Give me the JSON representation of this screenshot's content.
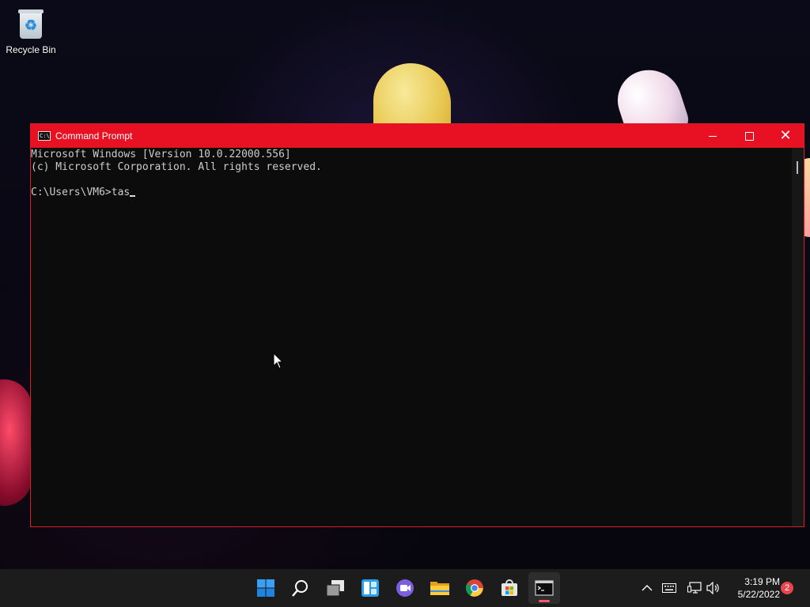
{
  "desktop": {
    "icons": [
      {
        "label": "Recycle Bin"
      }
    ]
  },
  "window": {
    "title": "Command Prompt",
    "console_lines": [
      "Microsoft Windows [Version 10.0.22000.556]",
      "(c) Microsoft Corporation. All rights reserved.",
      "",
      "C:\\Users\\VM6>tas"
    ]
  },
  "taskbar": {
    "apps": [
      "start-icon",
      "search-icon",
      "task-view-icon",
      "widgets-icon",
      "teams-chat-icon",
      "file-explorer-icon",
      "chrome-icon",
      "store-icon",
      "command-prompt-icon"
    ],
    "active_app": "command-prompt-icon",
    "tray": {
      "time": "3:19 PM",
      "date": "5/22/2022",
      "notification_count": "2"
    }
  },
  "colors": {
    "titlebar": "#e81123",
    "console_bg": "#0c0c0c",
    "taskbar_bg": "#1c1c1c",
    "badge": "#e8464e"
  }
}
